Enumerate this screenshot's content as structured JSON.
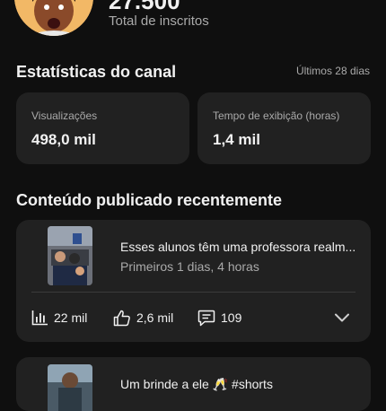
{
  "channel": {
    "subscriber_count": "27.500",
    "subscriber_label": "Total de inscritos"
  },
  "stats_section": {
    "title": "Estatísticas do canal",
    "period": "Últimos 28 dias",
    "cards": [
      {
        "label": "Visualizações",
        "value": "498,0 mil"
      },
      {
        "label": "Tempo de exibição (horas)",
        "value": "1,4 mil"
      }
    ]
  },
  "recent_section": {
    "title": "Conteúdo publicado recentemente",
    "videos": [
      {
        "title": "Esses alunos têm uma professora realm...",
        "subtitle": "Primeiros 1 dias, 4 horas",
        "views": "22 mil",
        "likes": "2,6 mil",
        "comments": "109"
      },
      {
        "title": "Um brinde a ele 🥂 #shorts",
        "subtitle": "",
        "views": "",
        "likes": "",
        "comments": ""
      }
    ]
  },
  "icons": {
    "views": "bar-chart-icon",
    "likes": "thumbs-up-icon",
    "comments": "comment-icon",
    "expand": "chevron-down-icon"
  },
  "colors": {
    "background": "#0f0f0f",
    "card": "#212121",
    "text_primary": "#f1f1f1",
    "text_secondary": "#aaaaaa"
  }
}
